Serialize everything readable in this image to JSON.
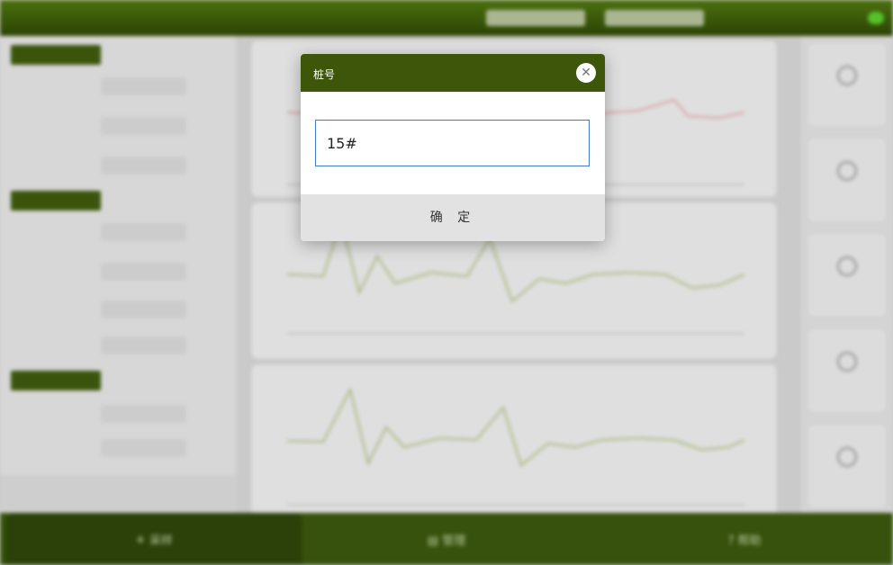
{
  "dialog": {
    "title": "桩号",
    "input_value": "15#",
    "confirm_label": "确 定",
    "close_icon": "close-icon"
  },
  "background": {
    "nav": {
      "tabs": [
        {
          "label": "采样",
          "icon": "sampling-icon",
          "active": true
        },
        {
          "label": "管理",
          "icon": "manage-icon",
          "active": false
        },
        {
          "label": "帮助",
          "icon": "help-icon",
          "active": false
        }
      ]
    }
  },
  "colors": {
    "header_green": "#3e560a",
    "input_border": "#3f7ec4",
    "footer_gray": "#e2e2e2",
    "chart_line": "#b8c98a"
  }
}
